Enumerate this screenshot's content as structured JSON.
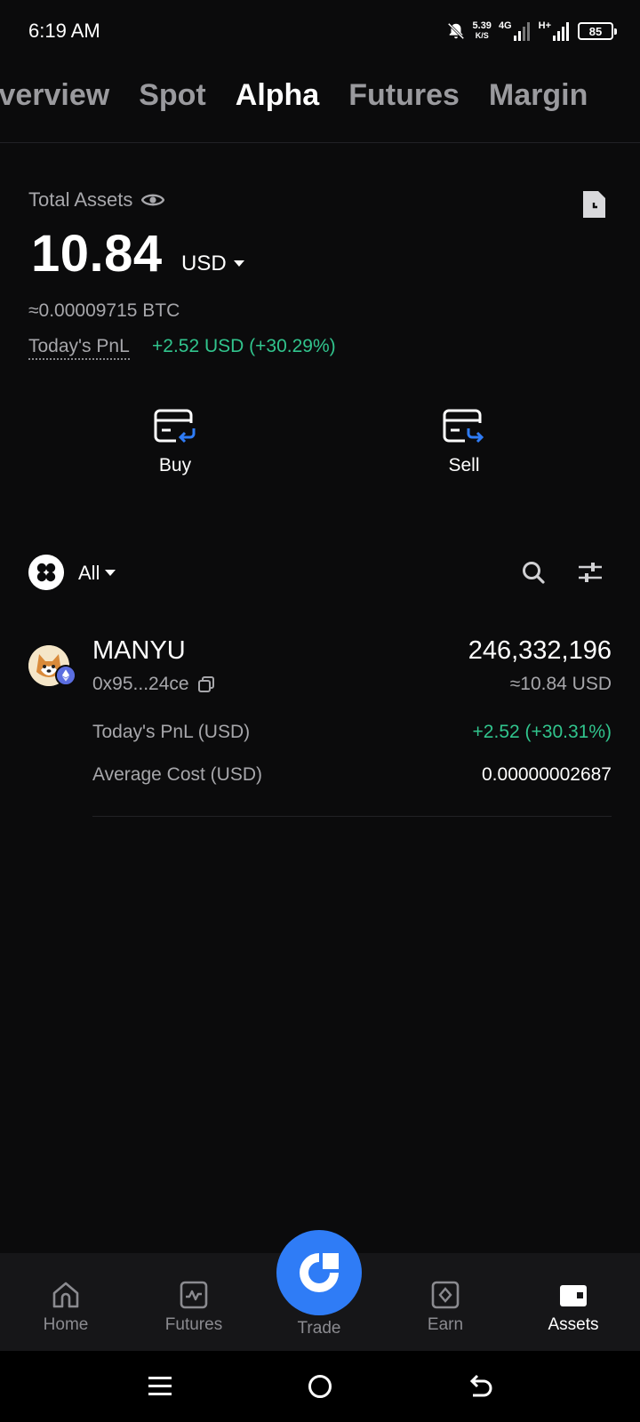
{
  "status_bar": {
    "time": "6:19 AM",
    "net_speed_value": "5.39",
    "net_speed_unit": "K/S",
    "network_label": "4G",
    "network2_label": "H+",
    "battery": "85"
  },
  "tabs": [
    {
      "label": "Overview",
      "active": false
    },
    {
      "label": "Spot",
      "active": false
    },
    {
      "label": "Alpha",
      "active": true
    },
    {
      "label": "Futures",
      "active": false
    },
    {
      "label": "Margin",
      "active": false
    }
  ],
  "total_assets": {
    "label": "Total Assets",
    "value": "10.84",
    "currency": "USD",
    "btc_equivalent": "≈0.00009715 BTC",
    "pnl_label": "Today's PnL",
    "pnl_value": "+2.52 USD (+30.29%)"
  },
  "actions": {
    "buy_label": "Buy",
    "sell_label": "Sell"
  },
  "filter": {
    "selected": "All"
  },
  "assets": [
    {
      "name": "MANYU",
      "address": "0x95...24ce",
      "amount": "246,332,196",
      "usd_value": "≈10.84 USD",
      "pnl_label": "Today's PnL (USD)",
      "pnl_value": "+2.52 (+30.31%)",
      "avg_cost_label": "Average Cost (USD)",
      "avg_cost_value": "0.00000002687"
    }
  ],
  "bottom_nav": {
    "home": "Home",
    "futures": "Futures",
    "trade": "Trade",
    "earn": "Earn",
    "assets": "Assets"
  },
  "colors": {
    "background": "#0b0b0c",
    "positive": "#31c48d",
    "accent": "#2f7cf6",
    "muted": "#a7a7ab"
  }
}
